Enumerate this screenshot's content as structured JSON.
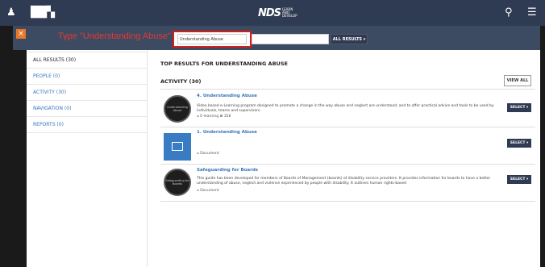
{
  "header": {
    "logo_text": "NDS",
    "logo_sub": "LEARN AND DEVELOP",
    "user_icon": "user-icon",
    "library_icon": "library-icon",
    "search_icon": "search-icon",
    "menu_icon": "menu-icon"
  },
  "search": {
    "close_label": "×",
    "instruction": "Type \"Understanding Abuse\" here ------->",
    "value": "Understanding Abuse",
    "filter_label": "ALL RESULTS ▾"
  },
  "sidebar": {
    "items": [
      {
        "label": "ALL RESULTS (30)"
      },
      {
        "label": "PEOPLE (0)"
      },
      {
        "label": "ACTIVITY (30)"
      },
      {
        "label": "NAVIGATION (0)"
      },
      {
        "label": "REPORTS (0)"
      }
    ]
  },
  "main": {
    "top_title": "TOP RESULTS FOR UNDERSTANDING ABUSE",
    "activity_title": "ACTIVITY (30)",
    "view_all": "VIEW ALL",
    "results": [
      {
        "thumb_text": "Understanding Abuse",
        "title": "4. Understanding Abuse",
        "desc": "Video based e-Learning program designed to promote a change in the way abuse and neglect are understood, and to offer practical advice and tools to be used by individuals, teams and supervisors.",
        "meta": "⌂ E-learning   ⊞ 358",
        "select": "SELECT ▾"
      },
      {
        "thumb_text": "",
        "title": "1. Understanding Abuse",
        "desc": "",
        "meta": "⌂ Document",
        "select": "SELECT ▾"
      },
      {
        "thumb_text": "Safeguarding for Boards",
        "title": "Safeguarding for Boards",
        "desc": "This guide has been developed for members of Boards of Management (boards) of disability service providers. It provides information for boards to have a better understanding of abuse, neglect and violence experienced by people with disability. It outlines human rights-based",
        "meta": "⌂ Document",
        "select": "SELECT ▾"
      }
    ]
  }
}
